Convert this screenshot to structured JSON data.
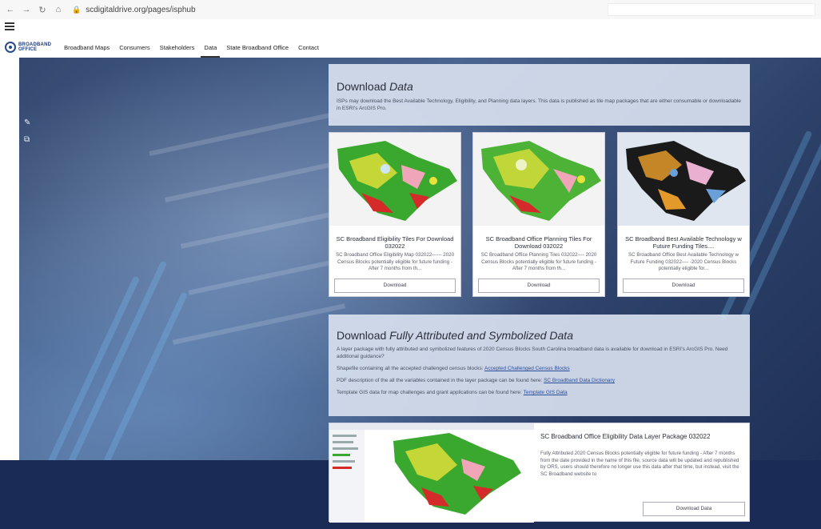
{
  "browser": {
    "url": "scdigitaldrive.org/pages/isphub"
  },
  "nav": {
    "logo_line1": "BROADBAND",
    "logo_line2": "OFFICE",
    "items": [
      "Broadband Maps",
      "Consumers",
      "Stakeholders",
      "Data",
      "State Broadband Office",
      "Contact"
    ],
    "active": "Data"
  },
  "download_data": {
    "title_plain": "Download ",
    "title_em": "Data",
    "description": "ISPs may download the Best Available Technology, Eligibility, and Planning data layers. This data is published as tile map packages that are either consumable or downloadable in ESRI's ArcGIS Pro."
  },
  "cards": [
    {
      "title": "SC Broadband Eligibility Tiles For Download 032022",
      "description": "SC Broadband Office Eligibility Map 032022------ 2020 Census Blocks potentially eligible for future funding - After 7 months from th...",
      "button": "Download"
    },
    {
      "title": "SC Broadband Office Planning Tiles For Download 032022",
      "description": "SC Broadband Office Planning Tiles 032022---- 2020 Census Blocks potentially eligible for future funding - After 7 months from th...",
      "button": "Download"
    },
    {
      "title": "SC Broadband Best Available Technology w Future Funding Tiles....",
      "description": "SC Broadband Office Best Available Technology w Future Funding 032022---- -2020 Census Blocks potentially eligible for...",
      "button": "Download"
    }
  ],
  "attributed": {
    "title_plain": "Download ",
    "title_em": "Fully Attributed and Symbolized Data",
    "description": "A layer package with fully attributed and symbolized features of 2020 Census Blocks South Carolina broadband data is available for download in ESRI's ArcGIS Pro. Need additional guidance?",
    "line1_text": "Shapefile containing all the accepted challenged census blocks: ",
    "line1_link": "Accepted Challenged Census Blocks",
    "line2_text": "PDF description of the all the variables contained in the layer package can be found here: ",
    "line2_link": "SC Broadband Data Dictionary",
    "line3_text": "Template GIS data for map challenges and grant applications can be found here: ",
    "line3_link": "Template GIS Data"
  },
  "layer_package": {
    "title": "SC Broadband Office Eligibility Data Layer Package 032022",
    "description": "Fully Attributed 2020 Census Blocks potentially eligible for future funding - After 7 months from the date provided in the name of this file, source data will be updated and republished by ORS, users should therefore no longer use this data after that time, but instead, visit the SC Broadband website to",
    "button": "Download Data"
  },
  "icons": {
    "edit": "pencil-icon",
    "share": "share-icon"
  },
  "colors": {
    "accent": "#1d3a78",
    "panel": "#d6dfee",
    "hero": "#33486f"
  }
}
